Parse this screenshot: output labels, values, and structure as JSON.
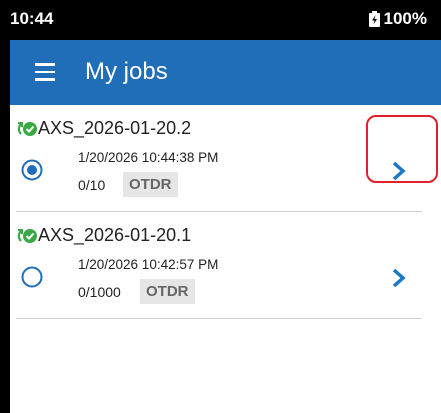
{
  "status_bar": {
    "time": "10:44",
    "battery": "100%"
  },
  "app_bar": {
    "title": "My jobs"
  },
  "jobs": [
    {
      "name": "AXS_2026-01-20.2",
      "datetime": "1/20/2026 10:44:38 PM",
      "count": "0/10",
      "tag": "OTDR",
      "selected": true
    },
    {
      "name": "AXS_2026-01-20.1",
      "datetime": "1/20/2026 10:42:57 PM",
      "count": "0/1000",
      "tag": "OTDR",
      "selected": false
    }
  ],
  "colors": {
    "accent": "#1f6eb7",
    "sync_green": "#3aa845",
    "highlight": "#e0202a"
  },
  "icons": {
    "menu": "hamburger-menu-icon",
    "sync": "sync-check-icon",
    "chevron": "chevron-right-icon",
    "battery": "battery-icon"
  }
}
